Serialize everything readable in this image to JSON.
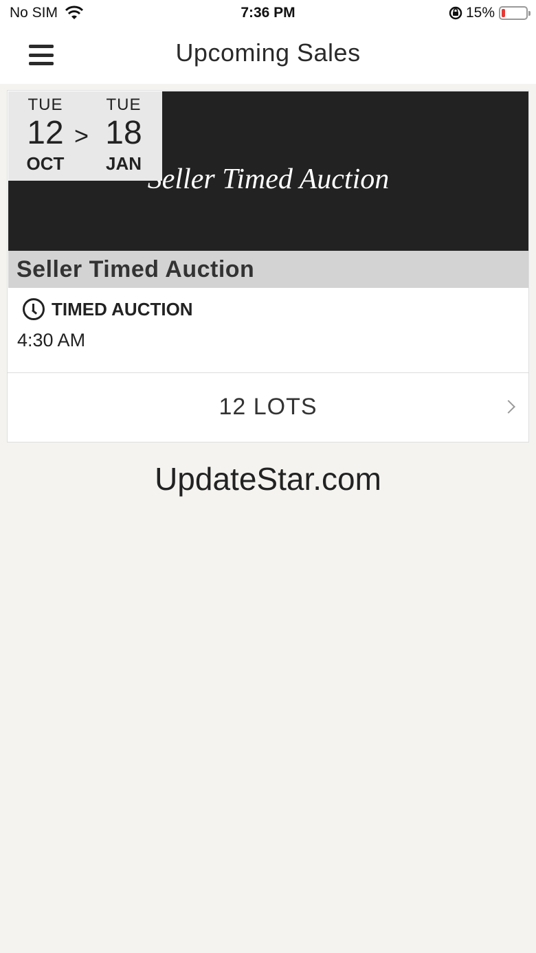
{
  "status_bar": {
    "carrier": "No SIM",
    "time": "7:36 PM",
    "battery_percent": "15%",
    "battery_level": 0.15,
    "icons": [
      "wifi-icon",
      "orientation-lock-icon",
      "battery-icon"
    ]
  },
  "nav": {
    "title": "Upcoming Sales",
    "menu_icon": "hamburger-icon"
  },
  "sale": {
    "banner_title": "Seller Timed Auction",
    "start": {
      "dow": "TUE",
      "day": "12",
      "month": "OCT"
    },
    "separator": ">",
    "end": {
      "dow": "TUE",
      "day": "18",
      "month": "JAN"
    },
    "title": "Seller Timed Auction",
    "type_label": "TIMED AUCTION",
    "time": "4:30 AM",
    "lots_label": "12 LOTS"
  },
  "watermark": "UpdateStar.com",
  "colors": {
    "banner_bg": "#222222",
    "title_bar_bg": "#d3d3d3",
    "page_bg": "#f4f3f0",
    "battery_low": "#e53935"
  }
}
